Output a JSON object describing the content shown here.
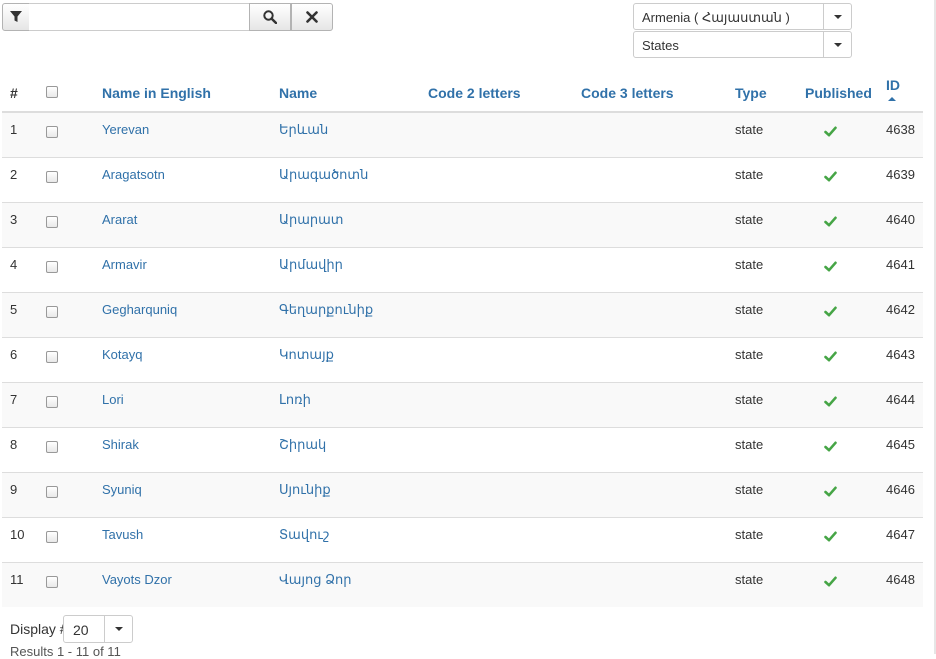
{
  "search": {
    "value": "",
    "placeholder": ""
  },
  "icons": {
    "filter": "filter-icon",
    "search": "search-icon",
    "clear": "close-icon",
    "published": "check-icon",
    "sort": "sort-asc-icon"
  },
  "filters": {
    "country": "Armenia ( Հայաստան )",
    "type": "States"
  },
  "columns": {
    "hash": "#",
    "name_en": "Name in English",
    "name": "Name",
    "code2": "Code 2 letters",
    "code3": "Code 3 letters",
    "type": "Type",
    "published": "Published",
    "id": "ID"
  },
  "rows": [
    {
      "num": "1",
      "name_en": "Yerevan",
      "name": "Երևան",
      "code2": "",
      "code3": "",
      "type": "state",
      "published": true,
      "id": "4638"
    },
    {
      "num": "2",
      "name_en": "Aragatsotn",
      "name": "Արագածոտն",
      "code2": "",
      "code3": "",
      "type": "state",
      "published": true,
      "id": "4639"
    },
    {
      "num": "3",
      "name_en": "Ararat",
      "name": "Արարատ",
      "code2": "",
      "code3": "",
      "type": "state",
      "published": true,
      "id": "4640"
    },
    {
      "num": "4",
      "name_en": "Armavir",
      "name": "Արմավիր",
      "code2": "",
      "code3": "",
      "type": "state",
      "published": true,
      "id": "4641"
    },
    {
      "num": "5",
      "name_en": "Gegharquniq",
      "name": "Գեղարքունիք",
      "code2": "",
      "code3": "",
      "type": "state",
      "published": true,
      "id": "4642"
    },
    {
      "num": "6",
      "name_en": "Kotayq",
      "name": "Կոտայք",
      "code2": "",
      "code3": "",
      "type": "state",
      "published": true,
      "id": "4643"
    },
    {
      "num": "7",
      "name_en": "Lori",
      "name": "Լոռի",
      "code2": "",
      "code3": "",
      "type": "state",
      "published": true,
      "id": "4644"
    },
    {
      "num": "8",
      "name_en": "Shirak",
      "name": "Շիրակ",
      "code2": "",
      "code3": "",
      "type": "state",
      "published": true,
      "id": "4645"
    },
    {
      "num": "9",
      "name_en": "Syuniq",
      "name": "Սյունիք",
      "code2": "",
      "code3": "",
      "type": "state",
      "published": true,
      "id": "4646"
    },
    {
      "num": "10",
      "name_en": "Tavush",
      "name": "Տավուշ",
      "code2": "",
      "code3": "",
      "type": "state",
      "published": true,
      "id": "4647"
    },
    {
      "num": "11",
      "name_en": "Vayots Dzor",
      "name": "Վայոց Ձոր",
      "code2": "",
      "code3": "",
      "type": "state",
      "published": true,
      "id": "4648"
    }
  ],
  "footer": {
    "display_label": "Display #",
    "display_value": "20",
    "results": "Results 1 - 11 of 11"
  },
  "colors": {
    "link": "#3071a9",
    "check": "#46a546",
    "stripe": "#f9f9f9"
  }
}
